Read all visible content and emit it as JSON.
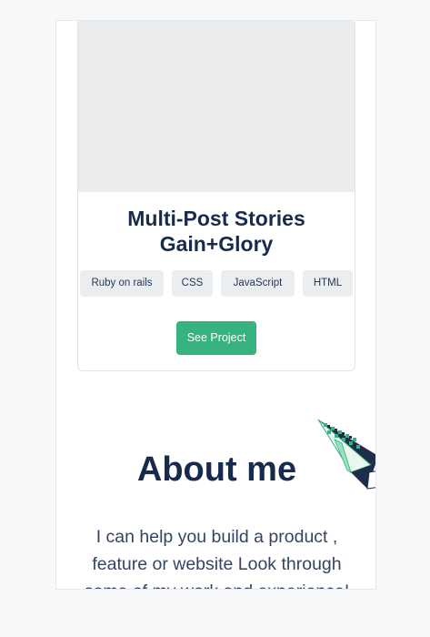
{
  "project_card": {
    "title": "Multi-Post Stories Gain+Glory",
    "tags": [
      "Ruby on rails",
      "CSS",
      "JavaScript",
      "HTML"
    ],
    "button_label": "See Project"
  },
  "about": {
    "title": "About me",
    "text": "I can help you build a product , feature or website Look through some of my work and experience!"
  },
  "colors": {
    "accent": "#36b37e",
    "heading": "#172b4d",
    "tag_bg": "#ebeef1",
    "image_placeholder": "#eaeced"
  },
  "decoration": {
    "icon": "paper-plane-illustration"
  }
}
